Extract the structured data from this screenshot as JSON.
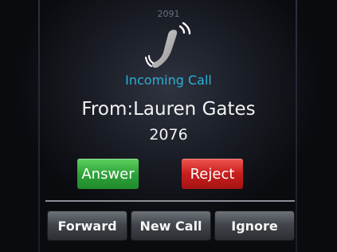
{
  "line": {
    "number": "2091"
  },
  "call": {
    "status": "Incoming Call",
    "from": "From:Lauren Gates",
    "number": "2076"
  },
  "actions": {
    "answer_label": "Answer",
    "reject_label": "Reject"
  },
  "softkeys": [
    {
      "label": "Forward"
    },
    {
      "label": "New Call"
    },
    {
      "label": "Ignore"
    }
  ],
  "icons": {
    "incoming": "ringing-phone-handset-icon"
  },
  "colors": {
    "status": "#2ab0d6",
    "answer": "#2ea43a",
    "reject": "#c81e1e",
    "softkey": "#42464c"
  }
}
